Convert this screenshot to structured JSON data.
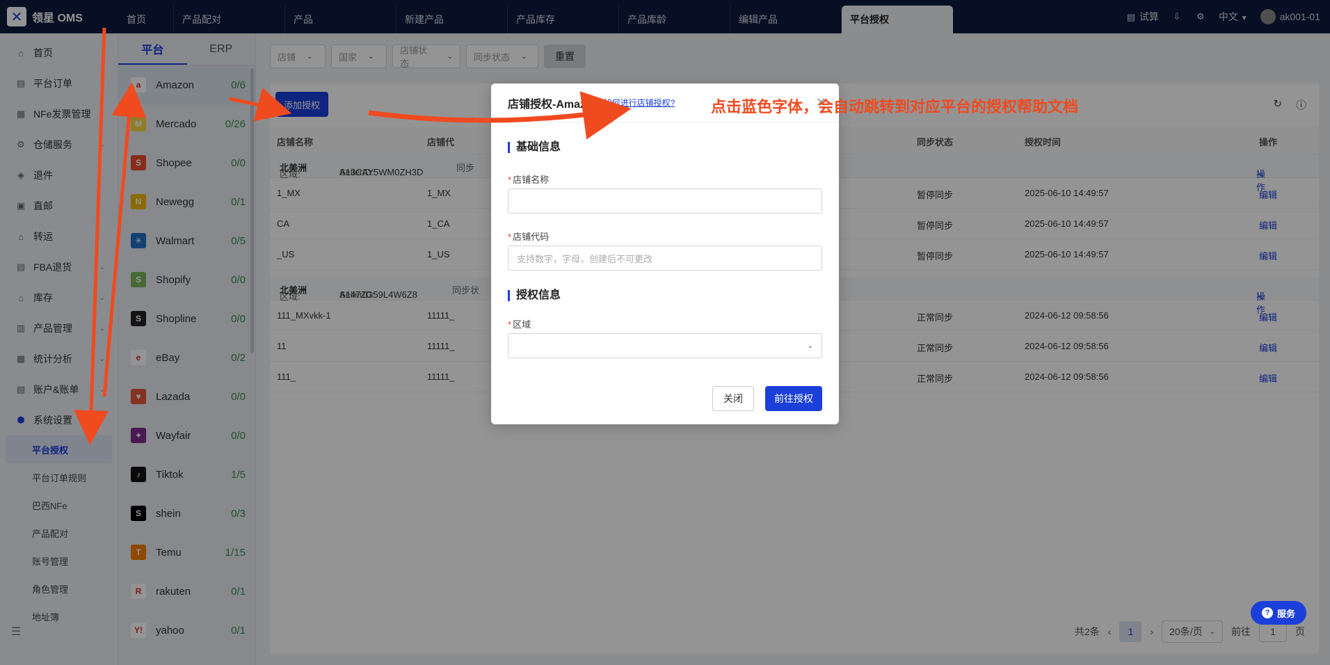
{
  "app": {
    "title": "领星 OMS"
  },
  "topnav": {
    "tabs": [
      "首页",
      "产品配对",
      "产品",
      "新建产品",
      "产品库存",
      "产品库龄",
      "编辑产品",
      "平台授权"
    ],
    "right": {
      "trial": "试算",
      "language": "中文",
      "user": "ak001-01"
    }
  },
  "sidebar": {
    "items": [
      {
        "label": "首页",
        "icon": "home-icon",
        "chev": ""
      },
      {
        "label": "平台订单",
        "icon": "order-icon",
        "chev": ""
      },
      {
        "label": "NFe发票管理",
        "icon": "invoice-icon",
        "chev": ""
      },
      {
        "label": "仓储服务",
        "icon": "warehouse-icon",
        "chev": "⌄"
      },
      {
        "label": "退件",
        "icon": "return-icon",
        "chev": ""
      },
      {
        "label": "直邮",
        "icon": "mail-icon",
        "chev": ""
      },
      {
        "label": "转运",
        "icon": "transfer-icon",
        "chev": ""
      },
      {
        "label": "FBA退货",
        "icon": "fba-icon",
        "chev": "⌄"
      },
      {
        "label": "库存",
        "icon": "inventory-icon",
        "chev": "⌄"
      },
      {
        "label": "产品管理",
        "icon": "product-icon",
        "chev": "⌄"
      },
      {
        "label": "统计分析",
        "icon": "chart-icon",
        "chev": "⌄"
      },
      {
        "label": "账户&账单",
        "icon": "account-icon",
        "chev": "⌄"
      },
      {
        "label": "系统设置",
        "icon": "settings-icon",
        "chev": "⌃"
      }
    ],
    "subitems": [
      "平台授权",
      "平台订单规则",
      "巴西NFe",
      "产品配对",
      "账号管理",
      "角色管理",
      "地址簿"
    ]
  },
  "platform_panel": {
    "tabs": [
      "平台",
      "ERP"
    ],
    "platforms": [
      {
        "name": "Amazon",
        "count": "0/6",
        "color": "#ffffff",
        "glyph": "a"
      },
      {
        "name": "Mercado",
        "count": "0/26",
        "color": "#f5d742",
        "glyph": "M"
      },
      {
        "name": "Shopee",
        "count": "0/0",
        "color": "#ee4d2d",
        "glyph": "S"
      },
      {
        "name": "Newegg",
        "count": "0/1",
        "color": "#f2b705",
        "glyph": "N"
      },
      {
        "name": "Walmart",
        "count": "0/5",
        "color": "#1f6fc5",
        "glyph": "✳"
      },
      {
        "name": "Shopify",
        "count": "0/0",
        "color": "#7ab55c",
        "glyph": "S"
      },
      {
        "name": "Shopline",
        "count": "0/0",
        "color": "#222222",
        "glyph": "S"
      },
      {
        "name": "eBay",
        "count": "0/2",
        "color": "#ffffff",
        "glyph": "e"
      },
      {
        "name": "Lazada",
        "count": "0/0",
        "color": "#e5533d",
        "glyph": "♥"
      },
      {
        "name": "Wayfair",
        "count": "0/0",
        "color": "#7b2d8e",
        "glyph": "✦"
      },
      {
        "name": "Tiktok",
        "count": "1/5",
        "color": "#111111",
        "glyph": "♪"
      },
      {
        "name": "shein",
        "count": "0/3",
        "color": "#000000",
        "glyph": "S"
      },
      {
        "name": "Temu",
        "count": "1/15",
        "color": "#f57c00",
        "glyph": "T"
      },
      {
        "name": "rakuten",
        "count": "0/1",
        "color": "#ffffff",
        "glyph": "R"
      },
      {
        "name": "yahoo",
        "count": "0/1",
        "color": "#ffffff",
        "glyph": "Y!"
      }
    ]
  },
  "filters": {
    "shop": "店铺",
    "country": "国家",
    "shop_status": "店铺状态",
    "sync_status": "同步状态",
    "reset": "重置"
  },
  "toolbar": {
    "add_auth": "添加授权"
  },
  "table": {
    "headers": [
      "店铺名称",
      "店铺代",
      "同步状态",
      "授权时间",
      "操作"
    ],
    "groups": [
      {
        "region_label": "区域:",
        "region": "北美洲",
        "seller_label": "SellerID:",
        "seller": "A13CAY5WM0ZH3D",
        "sync_prefix": "同步",
        "action": "操作"
      },
      {
        "region_label": "区域:",
        "region": "北美洲",
        "seller_label": "SellerID:",
        "seller": "A147ZG59L4W6Z8",
        "sync_prefix": "同步状",
        "action": "操作"
      }
    ],
    "rows": [
      {
        "name": "1_MX",
        "code": "1_MX",
        "sync": "暂停同步",
        "time": "2025-06-10 14:49:57",
        "action": "编辑"
      },
      {
        "name": "CA",
        "code": "1_CA",
        "sync": "暂停同步",
        "time": "2025-06-10 14:49:57",
        "action": "编辑"
      },
      {
        "name": "_US",
        "code": "1_US",
        "sync": "暂停同步",
        "time": "2025-06-10 14:49:57",
        "action": "编辑"
      },
      {
        "name": "111_MXvkk-1",
        "code": "11111_",
        "sync": "正常同步",
        "time": "2024-06-12 09:58:56",
        "action": "编辑"
      },
      {
        "name": "11",
        "code": "11111_",
        "sync": "正常同步",
        "time": "2024-06-12 09:58:56",
        "action": "编辑"
      },
      {
        "name": "111_",
        "code": "11111_",
        "sync": "正常同步",
        "time": "2024-06-12 09:58:56",
        "action": "编辑"
      }
    ]
  },
  "pagination": {
    "total": "共2条",
    "page": "1",
    "page_size": "20条/页",
    "goto_prefix": "前往",
    "goto_value": "1",
    "goto_suffix": "页"
  },
  "modal": {
    "title": "店铺授权-Amazon",
    "help_link": "如何进行店铺授权?",
    "section_basic": "基础信息",
    "shop_name_label": "店铺名称",
    "shop_code_label": "店铺代码",
    "shop_code_placeholder": "支持数字，字母，创建后不可更改",
    "section_auth": "授权信息",
    "region_label": "区域",
    "cancel": "关闭",
    "submit": "前往授权"
  },
  "annotation": {
    "text": "点击蓝色字体，会自动跳转到对应平台的授权帮助文档"
  },
  "service": {
    "label": "服务"
  },
  "colors": {
    "primary": "#1b3fd9",
    "topbar": "#0d1b3e",
    "annotation": "#f04a1f",
    "count_green": "#3c8c4a"
  }
}
